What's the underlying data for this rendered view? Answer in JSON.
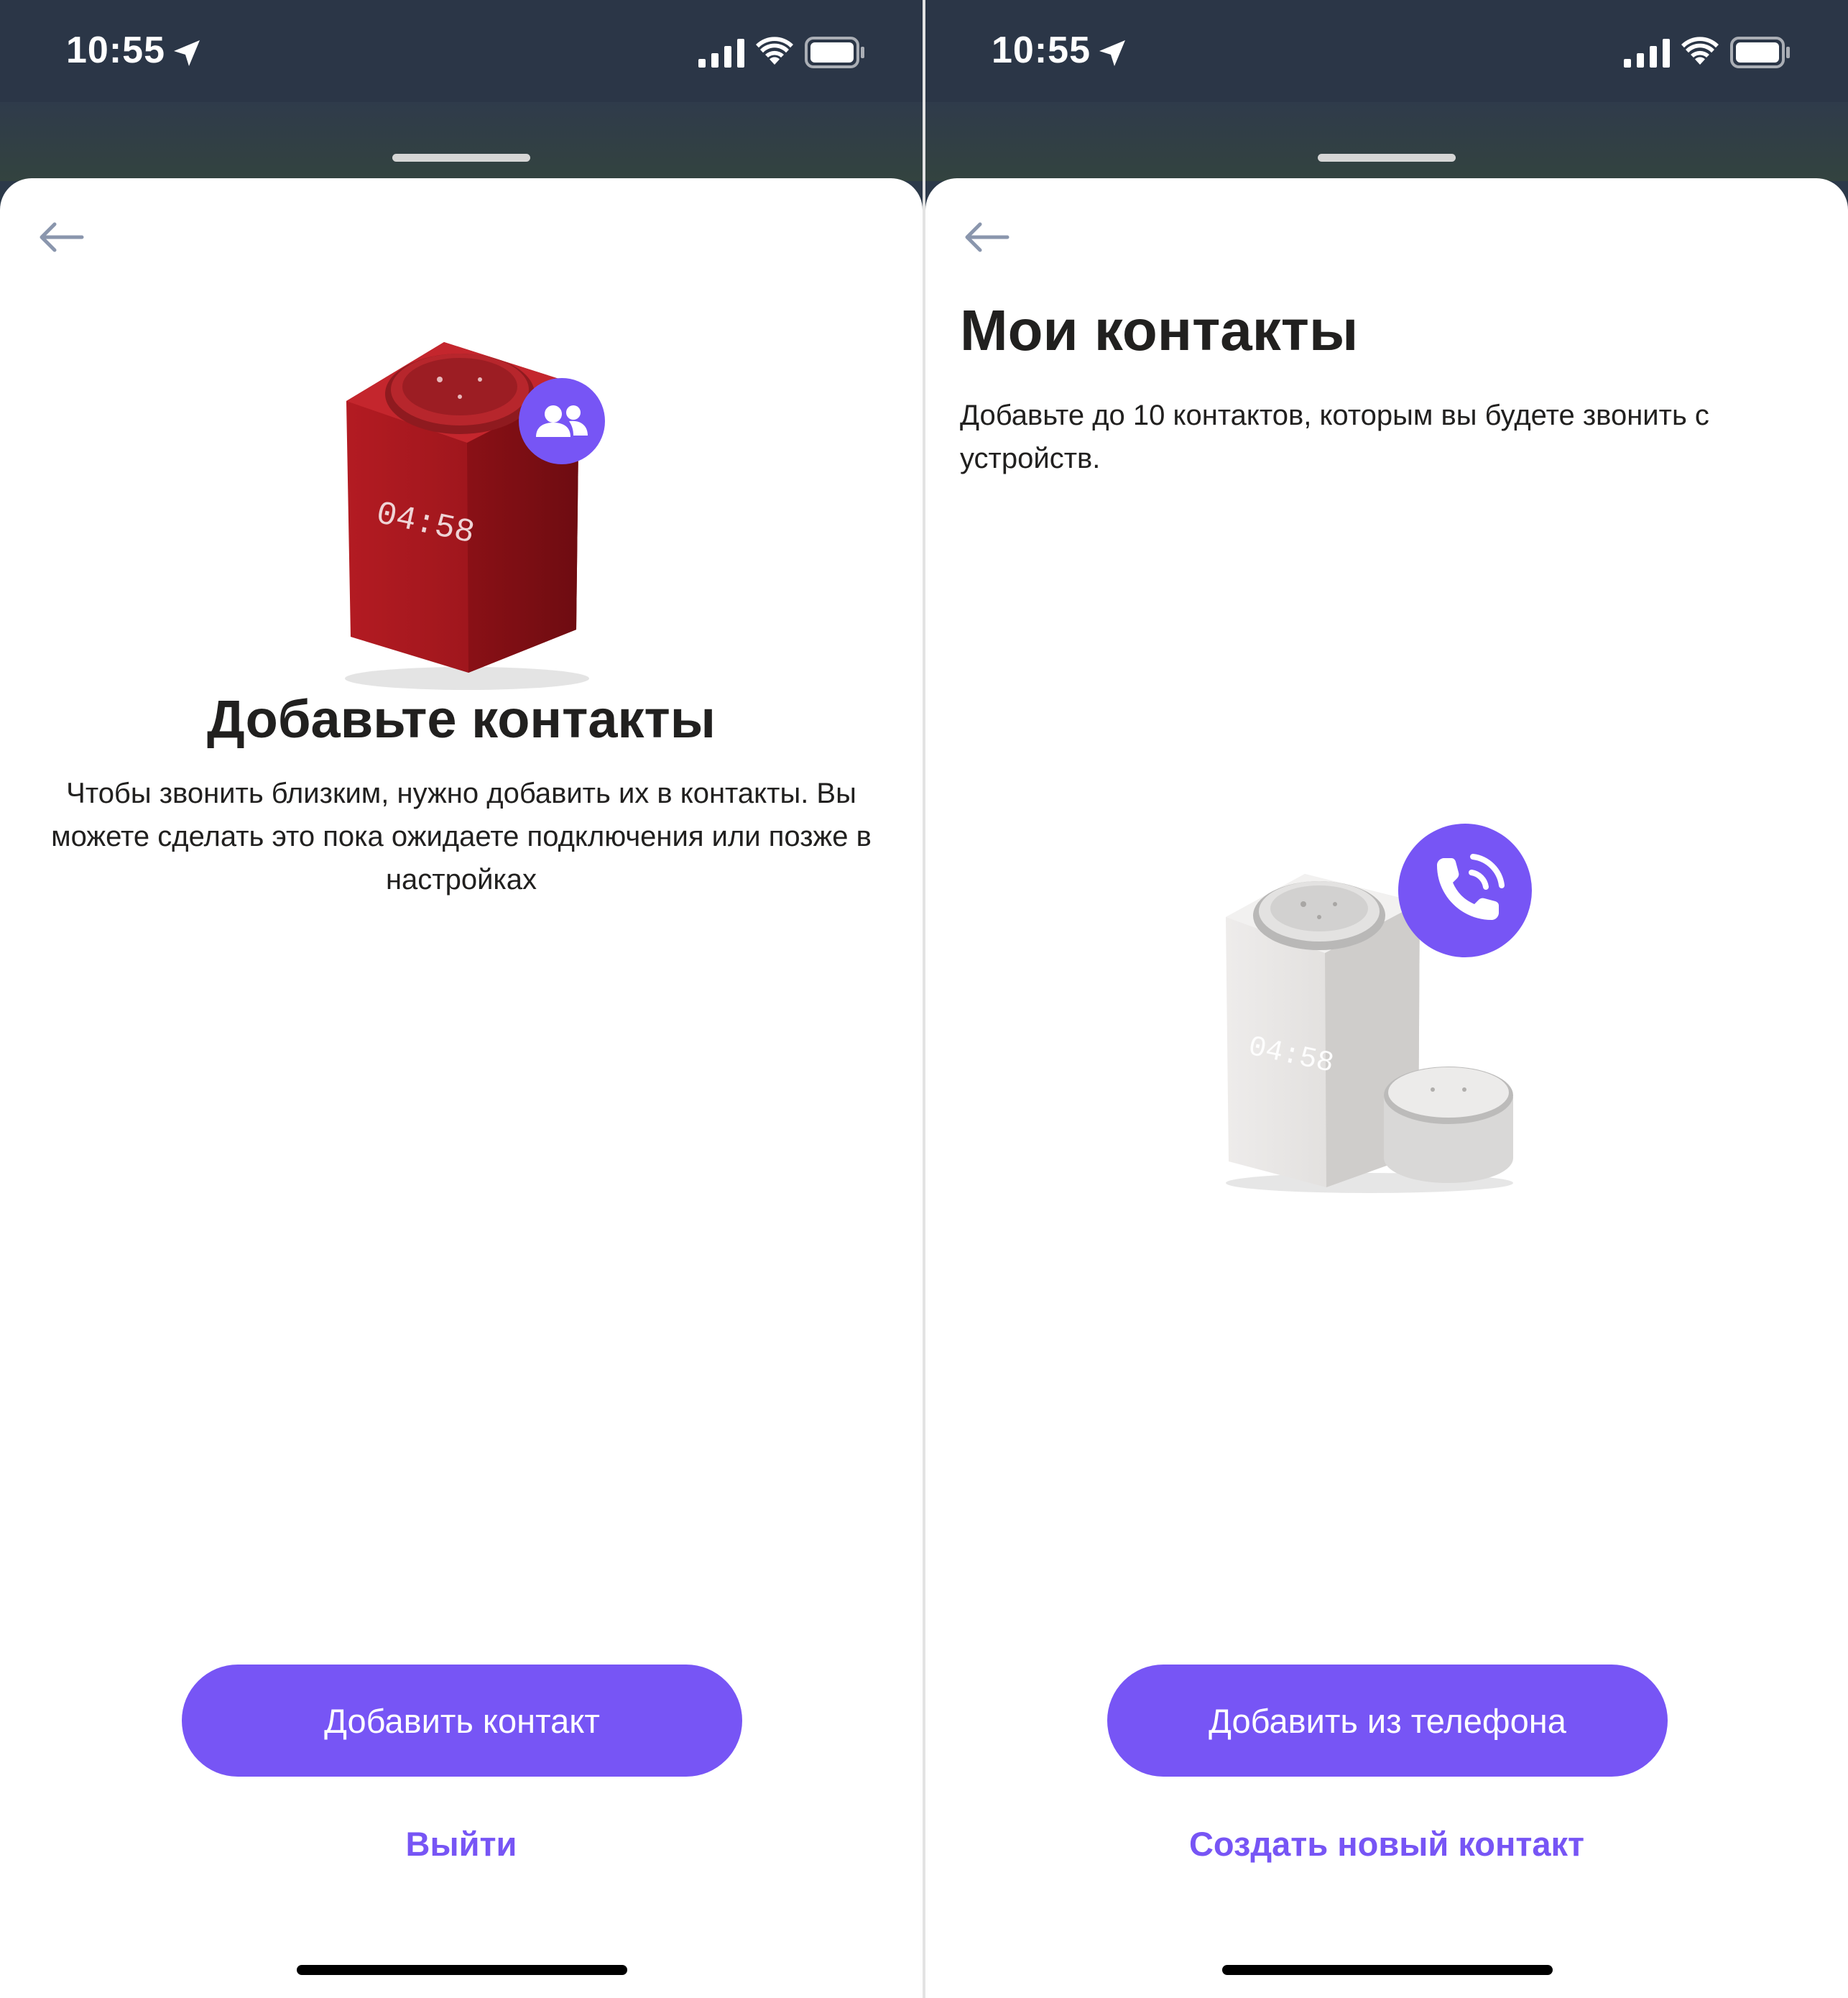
{
  "status_bar": {
    "time": "10:55"
  },
  "left_screen": {
    "title": "Добавьте контакты",
    "description": "Чтобы звонить близким, нужно добавить их в контакты. Вы можете сделать это пока ожидаете подключения или позже в настройках",
    "device_clock": "04:58",
    "primary_button": "Добавить контакт",
    "secondary_button": "Выйти"
  },
  "right_screen": {
    "title": "Мои контакты",
    "description": "Добавьте до 10 контактов, которым вы будете звонить с устройств.",
    "device_clock": "04:58",
    "primary_button": "Добавить из телефона",
    "secondary_button": "Создать новый контакт"
  },
  "colors": {
    "accent": "#7755f5",
    "status_bar_bg": "#2b3647",
    "text": "#21201f",
    "speaker_red": "#a3141c",
    "speaker_white": "#e6e4e2"
  }
}
